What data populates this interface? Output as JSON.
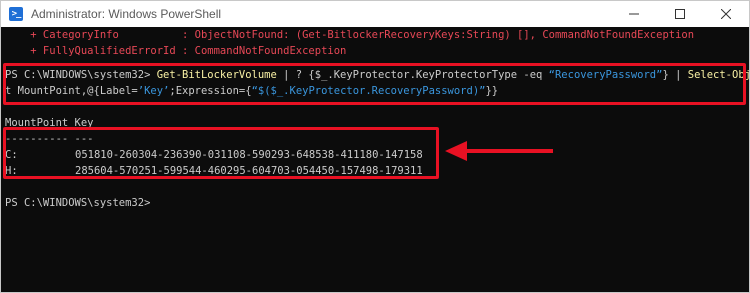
{
  "window": {
    "title": "Administrator: Windows PowerShell",
    "app_icon": "powershell-icon",
    "app_icon_glyph": ">_"
  },
  "controls": {
    "minimize": "minimize-icon",
    "maximize": "maximize-icon",
    "close": "close-icon"
  },
  "console": {
    "error_line_1": "    + CategoryInfo          : ObjectNotFound: (Get-BitlockerRecoveryKeys:String) [], CommandNotFoundException",
    "error_line_2": "    + FullyQualifiedErrorId : CommandNotFoundException",
    "prompt": "PS C:\\WINDOWS\\system32> ",
    "command_line_1": {
      "cmdlet": "Get-BitLockerVolume",
      "part_a": " | ? {$_.KeyProtector.KeyProtectorType -eq ",
      "string": "“RecoveryPassword”",
      "part_b": "} | ",
      "cmdlet2": "Select-Objec"
    },
    "command_line_2": {
      "part_a": "t MountPoint,@{Label=",
      "string_a": "’Key’",
      "part_b": ";Expression={",
      "string_b": "“$($_.KeyProtector.RecoveryPassword)”",
      "part_c": "}}"
    },
    "header": "MountPoint Key",
    "separator": "---------- ---",
    "rows": [
      {
        "mount": "C:",
        "key": "051810-260304-236390-031108-590293-648538-411180-147158"
      },
      {
        "mount": "H:",
        "key": "285604-570251-599544-460295-604703-054450-157498-179311"
      }
    ],
    "final_prompt": "PS C:\\WINDOWS\\system32>"
  },
  "annotation": {
    "color": "#e81123",
    "arrow": "left-arrow-icon"
  }
}
